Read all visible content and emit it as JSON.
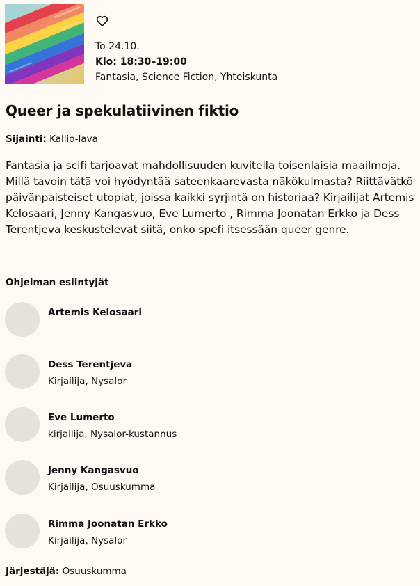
{
  "event": {
    "date": "To 24.10.",
    "time": "Klo: 18:30–19:00",
    "categories": "Fantasia, Science Fiction, Yhteiskunta",
    "title": "Queer ja spekulatiivinen fiktio",
    "location_label": "Sijainti:",
    "location": "Kallio-lava",
    "description": "Fantasia ja scifi tarjoavat mahdollisuuden kuvitella toisenlaisia maailmoja. Millä tavoin tätä voi hyödyntää sateenkaarevasta näkökulmasta? Riittävätkö päivänpaisteiset utopiat, joissa kaikki syrjintä on historiaa? Kirjailijat Artemis Kelosaari, Jenny Kangasvuo, Eve Lumerto , Rimma Joonatan Erkko ja Dess Terentjeva keskustelevat siitä, onko spefi itsessään queer genre.",
    "performers_title": "Ohjelman esiintyjät",
    "performers": [
      {
        "name": "Artemis Kelosaari",
        "role": ""
      },
      {
        "name": "Dess Terentjeva",
        "role": "Kirjailija, Nysalor"
      },
      {
        "name": "Eve Lumerto",
        "role": "kirjailija, Nysalor-kustannus"
      },
      {
        "name": "Jenny Kangasvuo",
        "role": "Kirjailija, Osuuskumma"
      },
      {
        "name": "Rimma Joonatan Erkko",
        "role": "Kirjailija, Nysalor"
      }
    ],
    "organizer_label": "Järjestäjä:",
    "organizer": "Osuuskumma"
  },
  "icons": {
    "favorite": "heart-outline-icon"
  },
  "colors": {
    "background": "#fef9f2",
    "avatar": "#e5e2dc",
    "text": "#111111"
  }
}
